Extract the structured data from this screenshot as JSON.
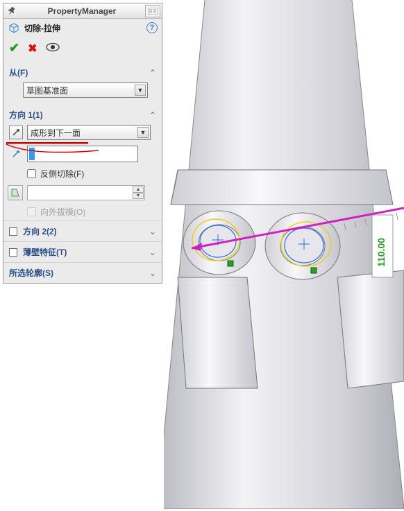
{
  "header": {
    "title": "PropertyManager"
  },
  "feature": {
    "title": "切除-拉伸"
  },
  "from": {
    "label": "从(F)",
    "option": "草图基准面"
  },
  "dir1": {
    "label": "方向 1(1)",
    "end_condition": "成形到下一面",
    "flip_side_label": "反侧切除(F)",
    "draft_outward_label": "向外拔模(O)"
  },
  "dir2": {
    "label": "方向 2(2)"
  },
  "thin": {
    "label": "薄壁特征(T)"
  },
  "contours": {
    "label": "所选轮廓(S)"
  }
}
